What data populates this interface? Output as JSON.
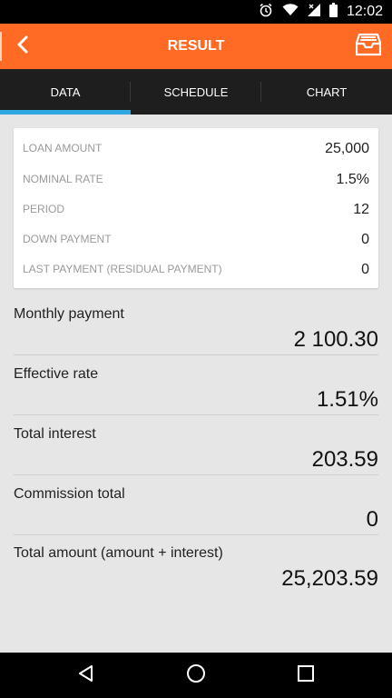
{
  "status": {
    "time": "12:02"
  },
  "appbar": {
    "title": "RESULT"
  },
  "tabs": [
    {
      "label": "DATA",
      "active": true
    },
    {
      "label": "SCHEDULE",
      "active": false
    },
    {
      "label": "CHART",
      "active": false
    }
  ],
  "inputs": [
    {
      "label": "LOAN AMOUNT",
      "value": "25,000"
    },
    {
      "label": "NOMINAL RATE",
      "value": "1.5%"
    },
    {
      "label": "PERIOD",
      "value": "12"
    },
    {
      "label": "DOWN PAYMENT",
      "value": "0"
    },
    {
      "label": "LAST PAYMENT (RESIDUAL PAYMENT)",
      "value": "0"
    }
  ],
  "results": [
    {
      "label": "Monthly payment",
      "value": "2 100.30"
    },
    {
      "label": "Effective rate",
      "value": "1.51%"
    },
    {
      "label": "Total interest",
      "value": "203.59"
    },
    {
      "label": "Commission total",
      "value": "0"
    },
    {
      "label": "Total amount (amount + interest)",
      "value": "25,203.59"
    }
  ],
  "colors": {
    "accent": "#ff6a24",
    "tab_indicator": "#2ea7e0",
    "tab_bar": "#1e1e1e"
  },
  "icons": {
    "back": "chevron-left-icon",
    "archive": "archive-icon",
    "alarm": "alarm-icon",
    "wifi": "wifi-icon",
    "signal": "signal-icon",
    "battery": "battery-icon"
  }
}
